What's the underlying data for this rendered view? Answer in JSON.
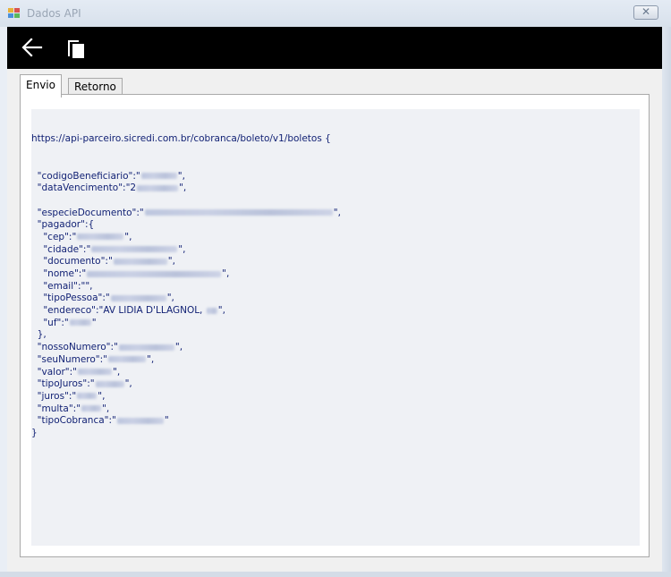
{
  "window": {
    "title": "Dados API",
    "close_glyph": "✕",
    "icon": "app-window-icon"
  },
  "toolbar": {
    "back_icon": "back-arrow-icon",
    "copy_icon": "copy-icon"
  },
  "tabs": [
    {
      "label": "Envio",
      "active": true
    },
    {
      "label": "Retorno",
      "active": false
    }
  ],
  "request": {
    "url_line": "https://api-parceiro.sicredi.com.br/cobranca/boleto/v1/boletos {",
    "lines": [
      {
        "text": "  \"codigoBeneficiario\":\"",
        "blur": true,
        "after": "\","
      },
      {
        "text": "  \"dataVencimento\":\"2",
        "blur": true,
        "after": "\","
      },
      {
        "text": "",
        "blur": false,
        "after": ""
      },
      {
        "text": "  \"especieDocumento\":\"",
        "blur": true,
        "after": "\","
      },
      {
        "text": "  \"pagador\":{",
        "blur": false,
        "after": ""
      },
      {
        "text": "    \"cep\":\"",
        "blur": true,
        "after": "\","
      },
      {
        "text": "    \"cidade\":\"",
        "blur": true,
        "after": "\","
      },
      {
        "text": "    \"documento\":\"",
        "blur": true,
        "after": "\","
      },
      {
        "text": "    \"nome\":\"",
        "blur": true,
        "after": "\","
      },
      {
        "text": "    \"email\":\"\",",
        "blur": false,
        "after": ""
      },
      {
        "text": "    \"tipoPessoa\":\"",
        "blur": true,
        "after": "\","
      },
      {
        "text": "    \"endereco\":\"AV LIDIA D'LLAGNOL, ",
        "blur": true,
        "after": "\","
      },
      {
        "text": "    \"uf\":\"",
        "blur": true,
        "after": "\""
      },
      {
        "text": "  },",
        "blur": false,
        "after": ""
      },
      {
        "text": "  \"nossoNumero\":\"",
        "blur": true,
        "after": "\","
      },
      {
        "text": "  \"seuNumero\":\"",
        "blur": true,
        "after": "\","
      },
      {
        "text": "  \"valor\":\"",
        "blur": true,
        "after": "\","
      },
      {
        "text": "  \"tipoJuros\":\"",
        "blur": true,
        "after": "\","
      },
      {
        "text": "  \"juros\":\"",
        "blur": true,
        "after": "\","
      },
      {
        "text": "  \"multa\":\"",
        "blur": true,
        "after": "\","
      },
      {
        "text": "  \"tipoCobranca\":\"",
        "blur": true,
        "after": "\""
      },
      {
        "text": "}",
        "blur": false,
        "after": ""
      }
    ]
  },
  "colors": {
    "code_text": "#0f1f73",
    "textbox_bg": "#eff1f5",
    "toolbar_bg": "#000000"
  }
}
